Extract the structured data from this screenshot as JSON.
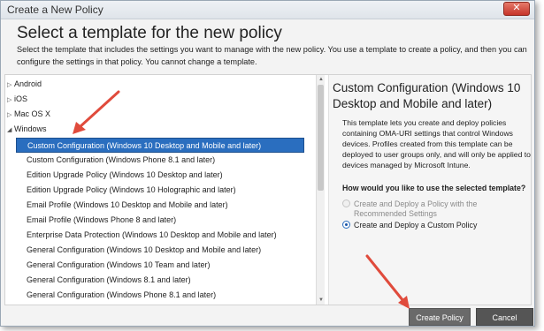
{
  "window": {
    "title": "Create a New Policy",
    "close_label": "✕"
  },
  "header": {
    "heading": "Select a template for the new policy",
    "description": "Select the template that includes the settings you want to manage with the new policy. You use a template to create a policy, and then you can configure the settings in that policy. You cannot change a template."
  },
  "tree": {
    "platforms": [
      {
        "label": "Android",
        "expanded": false
      },
      {
        "label": "iOS",
        "expanded": false
      },
      {
        "label": "Mac OS X",
        "expanded": false
      },
      {
        "label": "Windows",
        "expanded": true
      }
    ],
    "templates": [
      {
        "label": "Custom Configuration (Windows 10 Desktop and Mobile and later)",
        "selected": true
      },
      {
        "label": "Custom Configuration (Windows Phone 8.1 and later)"
      },
      {
        "label": "Edition Upgrade Policy (Windows 10 Desktop and later)"
      },
      {
        "label": "Edition Upgrade Policy (Windows 10 Holographic and later)"
      },
      {
        "label": "Email Profile (Windows 10 Desktop and Mobile and later)"
      },
      {
        "label": "Email Profile (Windows Phone 8 and later)"
      },
      {
        "label": "Enterprise Data Protection (Windows 10 Desktop and Mobile and later)"
      },
      {
        "label": "General Configuration (Windows 10 Desktop and Mobile and later)"
      },
      {
        "label": "General Configuration (Windows 10 Team and later)"
      },
      {
        "label": "General Configuration (Windows 8.1 and later)"
      },
      {
        "label": "General Configuration (Windows Phone 8.1 and later)"
      }
    ]
  },
  "details": {
    "title": "Custom Configuration (Windows 10 Desktop and Mobile and later)",
    "body": "This template lets you create and deploy policies containing OMA-URI settings that control Windows devices. Profiles created from this template can be deployed to user groups only, and will only be applied to devices managed by Microsoft Intune.",
    "question": "How would you like to use the selected template?",
    "options": [
      {
        "label": "Create and Deploy a Policy with the Recommended Settings",
        "checked": false,
        "disabled": true
      },
      {
        "label": "Create and Deploy a Custom Policy",
        "checked": true,
        "disabled": false
      }
    ]
  },
  "footer": {
    "create_label": "Create Policy",
    "cancel_label": "Cancel"
  },
  "colors": {
    "selection": "#2a6ebf",
    "annotation_arrow": "#e04b3c"
  }
}
